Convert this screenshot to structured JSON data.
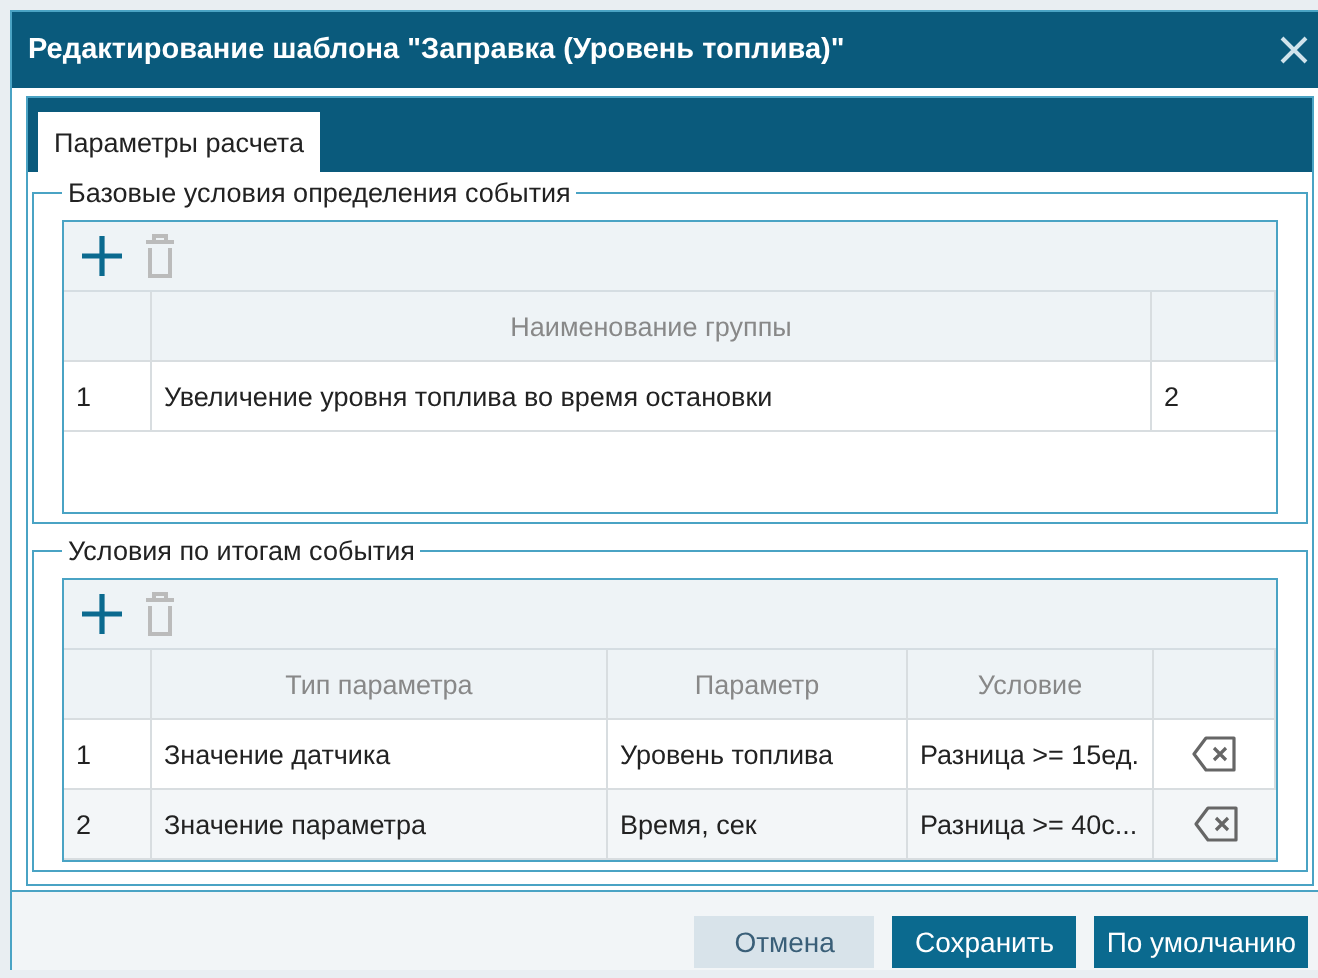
{
  "window": {
    "title": "Редактирование шаблона \"Заправка (Уровень топлива)\""
  },
  "tabs": [
    {
      "label": "Параметры расчета",
      "selected": true
    }
  ],
  "sections": [
    {
      "legend": "Базовые условия определения события",
      "toolbar": {
        "add_disabled": false,
        "delete_disabled": true
      },
      "columns": [
        {
          "kind": "number"
        },
        {
          "kind": "text",
          "label": "Наименование группы"
        },
        {
          "kind": "text"
        }
      ],
      "rows": [
        {
          "cells": [
            "1",
            "Увеличение уровня топлива во время остановки",
            "2"
          ]
        }
      ]
    },
    {
      "legend": "Условия по итогам события",
      "toolbar": {
        "add_disabled": false,
        "delete_disabled": true
      },
      "columns": [
        {
          "kind": "number"
        },
        {
          "kind": "text",
          "label": "Тип параметра"
        },
        {
          "kind": "text",
          "label": "Параметр"
        },
        {
          "kind": "text",
          "label": "Условие"
        },
        {
          "kind": "action"
        }
      ],
      "rows": [
        {
          "cells": [
            "1",
            "Значение датчика",
            "Уровень топлива",
            "Разница >= 15ед."
          ]
        },
        {
          "cells": [
            "2",
            "Значение параметра",
            "Время, сек",
            "Разница >= 40с..."
          ]
        }
      ]
    }
  ],
  "buttons": [
    {
      "label": "Отмена",
      "kind": "secondary"
    },
    {
      "label": "Сохранить",
      "kind": "primary"
    },
    {
      "label": "По умолчанию",
      "kind": "primary"
    }
  ]
}
